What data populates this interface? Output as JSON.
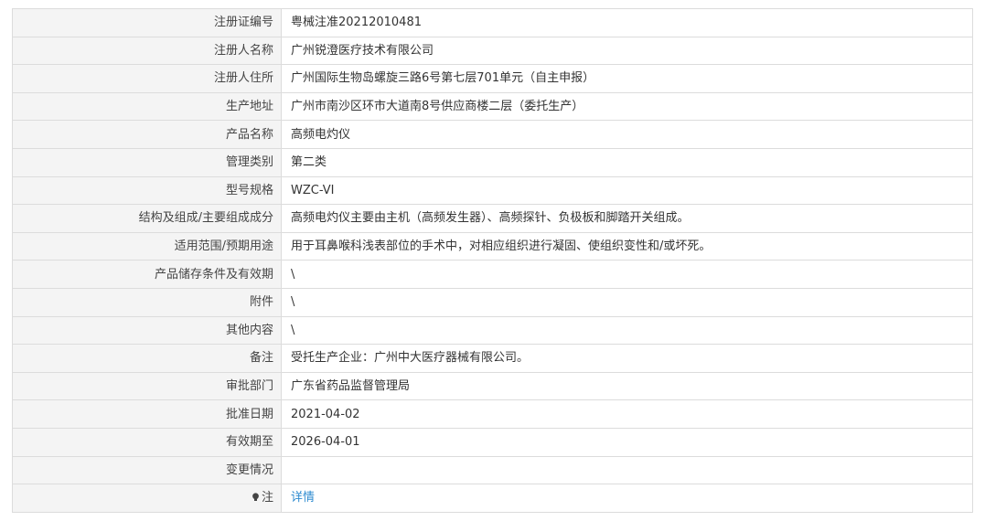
{
  "rows": [
    {
      "label": "注册证编号",
      "value": "粤械注准20212010481"
    },
    {
      "label": "注册人名称",
      "value": "广州锐澄医疗技术有限公司"
    },
    {
      "label": "注册人住所",
      "value": "广州国际生物岛螺旋三路6号第七层701单元（自主申报）"
    },
    {
      "label": "生产地址",
      "value": "广州市南沙区环市大道南8号供应商楼二层（委托生产）"
    },
    {
      "label": "产品名称",
      "value": "高频电灼仪"
    },
    {
      "label": "管理类别",
      "value": "第二类"
    },
    {
      "label": "型号规格",
      "value": "WZC-VI"
    },
    {
      "label": "结构及组成/主要组成成分",
      "value": "高频电灼仪主要由主机（高频发生器）、高频探针、负极板和脚踏开关组成。"
    },
    {
      "label": "适用范围/预期用途",
      "value": "用于耳鼻喉科浅表部位的手术中，对相应组织进行凝固、使组织变性和/或坏死。"
    },
    {
      "label": "产品储存条件及有效期",
      "value": "\\"
    },
    {
      "label": "附件",
      "value": "\\"
    },
    {
      "label": "其他内容",
      "value": "\\"
    },
    {
      "label": "备注",
      "value": "受托生产企业：广州中大医疗器械有限公司。"
    },
    {
      "label": "审批部门",
      "value": "广东省药品监督管理局"
    },
    {
      "label": "批准日期",
      "value": "2021-04-02"
    },
    {
      "label": "有效期至",
      "value": "2026-04-01"
    },
    {
      "label": "变更情况",
      "value": ""
    }
  ],
  "note": {
    "icon": "bulb-icon",
    "label": "注",
    "link_text": "详情",
    "link_color": "#2e8bd0"
  }
}
